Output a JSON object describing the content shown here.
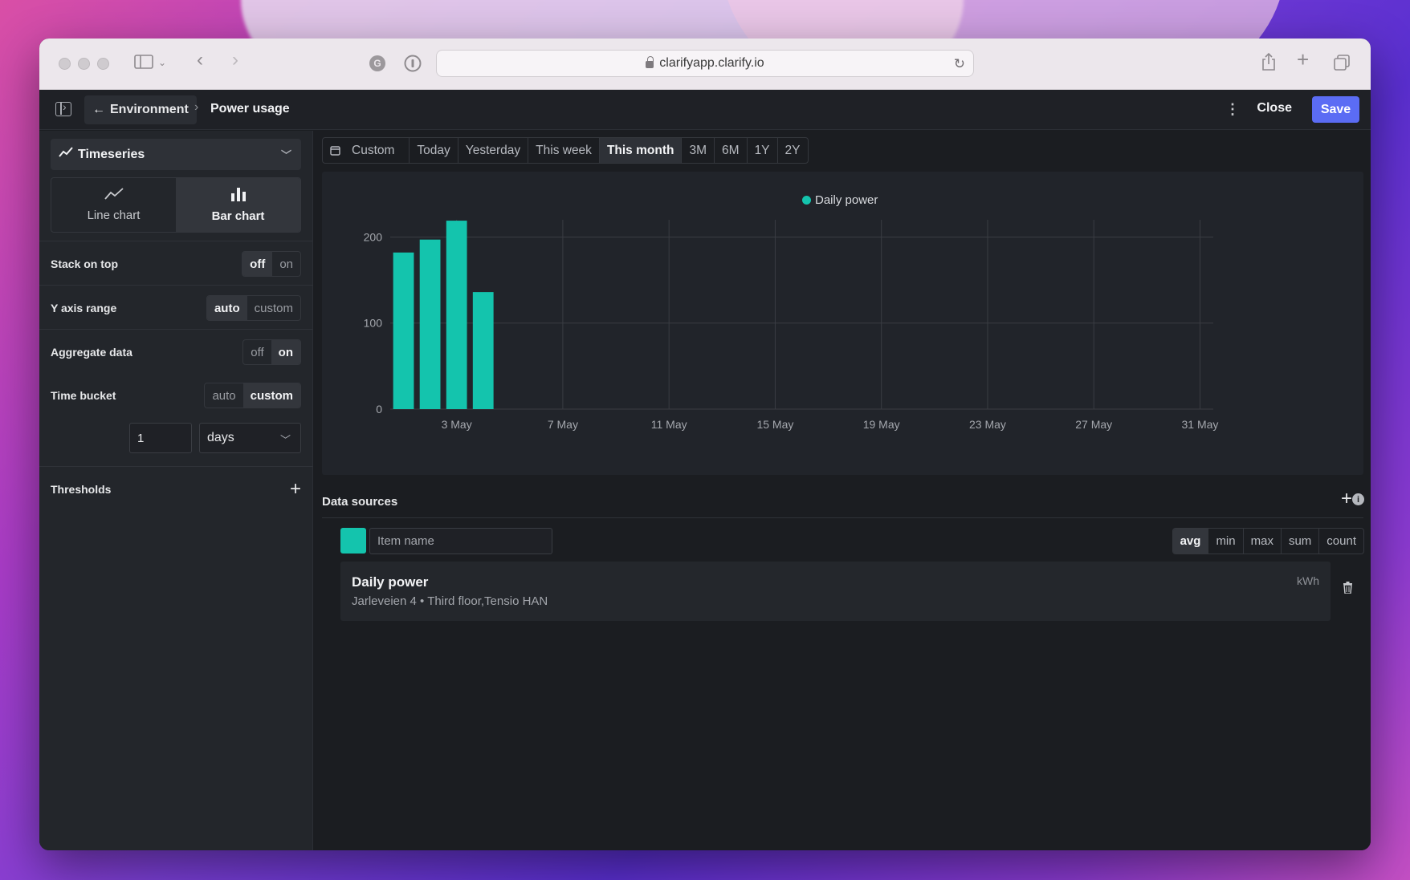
{
  "browser": {
    "url": "clarifyapp.clarify.io"
  },
  "header": {
    "back_label": "Environment",
    "current_page": "Power usage",
    "close_label": "Close",
    "save_label": "Save",
    "accent": "#5b6cf4"
  },
  "sidebar": {
    "visualization_type": "Timeseries",
    "chart_types": [
      {
        "label": "Line chart",
        "icon": "line-chart-icon",
        "active": false
      },
      {
        "label": "Bar chart",
        "icon": "bar-chart-icon",
        "active": true
      }
    ],
    "stack_on_top": {
      "label": "Stack on top",
      "options": [
        "off",
        "on"
      ],
      "selected": "off"
    },
    "y_axis_range": {
      "label": "Y axis range",
      "options": [
        "auto",
        "custom"
      ],
      "selected": "auto"
    },
    "aggregate_data": {
      "label": "Aggregate data",
      "options": [
        "off",
        "on"
      ],
      "selected": "on"
    },
    "time_bucket": {
      "label": "Time bucket",
      "options": [
        "auto",
        "custom"
      ],
      "selected": "custom",
      "value": "1",
      "unit": "days"
    },
    "thresholds_label": "Thresholds"
  },
  "time_ranges": {
    "options": [
      "Custom",
      "Today",
      "Yesterday",
      "This week",
      "This month",
      "3M",
      "6M",
      "1Y",
      "2Y"
    ],
    "selected": "This month"
  },
  "chart_data": {
    "type": "bar",
    "legend": [
      "Daily power"
    ],
    "legend_placement": "top-center",
    "series": [
      {
        "name": "Daily power",
        "color": "#14c4ad",
        "x": [
          "1 May",
          "2 May",
          "3 May",
          "4 May"
        ],
        "values": [
          182,
          197,
          219,
          136
        ]
      }
    ],
    "x_range": [
      "1 May",
      "31 May"
    ],
    "x_ticks": [
      "3 May",
      "7 May",
      "11 May",
      "15 May",
      "19 May",
      "23 May",
      "27 May",
      "31 May"
    ],
    "y_ticks": [
      0,
      100,
      200
    ],
    "ylim": [
      0,
      220
    ],
    "grid": true
  },
  "data_sources": {
    "title": "Data sources",
    "item_placeholder": "Item name",
    "aggregations": [
      "avg",
      "min",
      "max",
      "sum",
      "count"
    ],
    "selected_aggregation": "avg",
    "items": [
      {
        "name": "Daily power",
        "subtitle": "Jarleveien 4 • Third floor,Tensio HAN",
        "unit": "kWh",
        "color": "#14c4ad"
      }
    ]
  }
}
